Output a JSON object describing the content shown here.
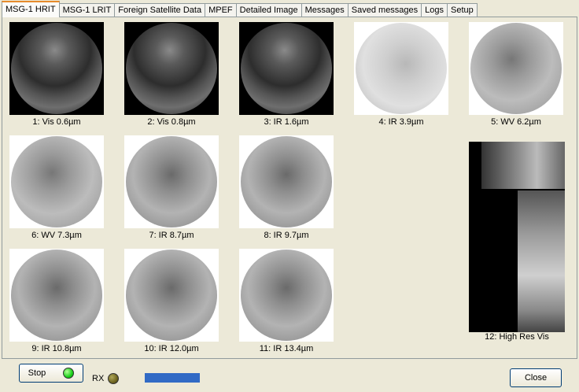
{
  "tabs": [
    "MSG-1 HRIT",
    "MSG-1 LRIT",
    "Foreign Satellite Data",
    "MPEF",
    "Detailed Image",
    "Messages",
    "Saved messages",
    "Logs",
    "Setup"
  ],
  "active_tab": "MSG-1 HRIT",
  "channels": [
    {
      "caption": "1:  Vis 0.6µm"
    },
    {
      "caption": "2:  Vis 0.8µm"
    },
    {
      "caption": "3:  IR 1.6µm"
    },
    {
      "caption": "4:  IR 3.9µm"
    },
    {
      "caption": "5:  WV 6.2µm"
    },
    {
      "caption": "6:  WV 7.3µm"
    },
    {
      "caption": "7:  IR 8.7µm"
    },
    {
      "caption": "8:  IR 9.7µm"
    },
    {
      "caption": "9:  IR 10.8µm"
    },
    {
      "caption": "10:  IR 12.0µm"
    },
    {
      "caption": "11:  IR 13.4µm"
    },
    {
      "caption": "12:  High Res Vis"
    }
  ],
  "controls": {
    "stop_label": "Stop",
    "rx_label": "RX",
    "close_label": "Close",
    "progress": 1.0,
    "colors": {
      "stop_led": "#1ad11a",
      "rx_led": "#6e6520",
      "progress": "#316ac5"
    }
  }
}
